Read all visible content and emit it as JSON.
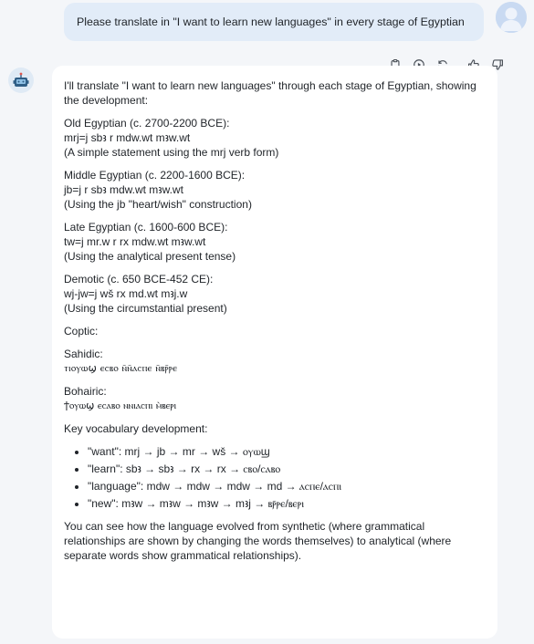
{
  "user": {
    "message": "Please translate in \"I want to learn new languages\" in every stage of Egyptian"
  },
  "toolbar": {
    "icons": [
      "clipboard-icon",
      "play-icon",
      "refresh-icon",
      "thumbs-up-icon",
      "thumbs-down-icon"
    ]
  },
  "answer": {
    "intro": "I'll translate \"I want to learn new languages\" through each stage of Egyptian, showing the development:",
    "stages": [
      {
        "title": "Old Egyptian (c. 2700-2200 BCE):",
        "text": "mrj=j sbꜣ r mdw.wt mꜣw.wt",
        "note": "(A simple statement using the mrj verb form)"
      },
      {
        "title": "Middle Egyptian (c. 2200-1600 BCE):",
        "text": "jb=j r sbꜣ mdw.wt mꜣw.wt",
        "note": "(Using the jb \"heart/wish\" construction)"
      },
      {
        "title": "Late Egyptian (c. 1600-600 BCE):",
        "text": "tw=j mr.w r rx mdw.wt mꜣw.wt",
        "note": "(Using the analytical present tense)"
      },
      {
        "title": "Demotic (c. 650 BCE-452 CE):",
        "text": "wj-jw=j wš rx md.wt mꜣj.w",
        "note": "(Using the circumstantial present)"
      }
    ],
    "coptic_label": "Coptic:",
    "sahidic_label": "Sahidic:",
    "sahidic_text": "ⲧⲓⲟⲩⲱϣ ⲉⲥⲃⲟ ⲛ̄ⲛ̄ⲁⲥⲡⲉ ⲛ̄ⲃⲣ̄ⲣⲉ",
    "bohairic_label": "Bohairic:",
    "bohairic_text": "ϯⲟⲩⲱϣ ⲉⲥⲁⲃⲟ ⲛⲛⲓⲁⲥⲡⲓ ⲙ̀ⲃⲉⲣⲓ",
    "vocab_label": "Key vocabulary development:",
    "vocab": [
      "\"want\": mrj → jb → mr → wš → ⲟⲩⲱϣ",
      "\"learn\": sbꜣ → sbꜣ → rx → rx → ⲥⲃⲟ/ⲥⲁⲃⲟ",
      "\"language\": mdw → mdw → mdw → md → ⲁⲥⲡⲉ/ⲁⲥⲡⲓ",
      "\"new\": mꜣw → mꜣw → mꜣw → mꜣj → ⲃⲣ̄ⲣⲉ/ⲃⲉⲣⲓ"
    ],
    "conclusion": "You can see how the language evolved from synthetic (where grammatical relationships are shown by changing the words themselves) to analytical (where separate words show grammatical relationships)."
  }
}
